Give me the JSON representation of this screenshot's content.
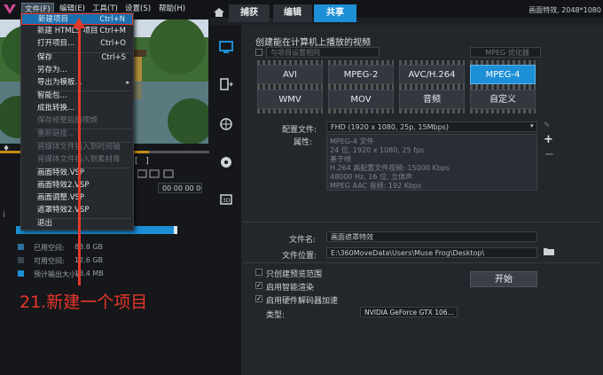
{
  "menubar": {
    "items": [
      {
        "label": "文件(F)",
        "active": true
      },
      {
        "label": "编辑(E)"
      },
      {
        "label": "工具(T)"
      },
      {
        "label": "设置(S)"
      },
      {
        "label": "帮助(H)"
      }
    ],
    "title": "画面特效, 2048*1080"
  },
  "tabs": [
    {
      "label": "捕获"
    },
    {
      "label": "编辑"
    },
    {
      "label": "共享",
      "selected": true
    }
  ],
  "file_menu": {
    "items": [
      {
        "label": "新建项目",
        "shortcut": "Ctrl+N",
        "highlight": true
      },
      {
        "label": "新建 HTML5 项目",
        "shortcut": "Ctrl+M"
      },
      {
        "label": "打开项目...",
        "shortcut": "Ctrl+O"
      },
      {
        "label": "保存",
        "shortcut": "Ctrl+S"
      },
      {
        "label": "另存为..."
      },
      {
        "label": "导出为模板...",
        "submenu": true
      },
      {
        "label": "智能包..."
      },
      {
        "label": "成批转换..."
      },
      {
        "label": "保存修整后的视频",
        "disabled": true
      },
      {
        "label": "重新链接...",
        "disabled": true
      },
      {
        "label": "将媒体文件插入到时间轴",
        "disabled": true
      },
      {
        "label": "将媒体文件插入到素材库",
        "disabled": true
      },
      {
        "label": "画面特效.VSP"
      },
      {
        "label": "画面特效2.VSP"
      },
      {
        "label": "画面调整.VSP"
      },
      {
        "label": "遮罩特效2.VSP"
      },
      {
        "label": "退出"
      }
    ]
  },
  "annotation": "21.新建一个项目",
  "left_stats": [
    {
      "label": "已用空间:",
      "value": "83.8 GB",
      "color": "#2e6f9e"
    },
    {
      "label": "可用空间:",
      "value": "12.6 GB",
      "color": "#3d4650"
    },
    {
      "label": "预计输出大小:",
      "value": "13.4 MB",
      "color": "#1c8fd6"
    }
  ],
  "timecode": "00 00 00 00",
  "share": {
    "heading": "创建能在计算机上播放的视频",
    "checkbox_top_label": "与项目设置相同",
    "optimize_label": "MPEG 优化器",
    "formats_row1": [
      {
        "label": "AVI"
      },
      {
        "label": "MPEG-2"
      },
      {
        "label": "AVC/H.264"
      },
      {
        "label": "MPEG-4",
        "selected": true
      }
    ],
    "formats_row2": [
      {
        "label": "WMV"
      },
      {
        "label": "MOV"
      },
      {
        "label": "音频"
      },
      {
        "label": "自定义"
      }
    ],
    "profile_label": "配置文件:",
    "profile_value": "FHD (1920 x 1080, 25p, 15Mbps)",
    "properties_label": "属性:",
    "properties": [
      "MPEG-4 文件",
      "24 位, 1920 x 1080, 25 fps",
      "基于帧",
      "H.264 高配置文件视频: 15000 Kbps",
      "48000 Hz, 16 位, 立体声",
      "MPEG AAC 音频: 192 Kbps"
    ],
    "filename_label": "文件名:",
    "filename_value": "画面遮罩特效",
    "location_label": "文件位置:",
    "location_value": "E:\\360MoveData\\Users\\Muse Frog\\Desktop\\",
    "options": [
      {
        "label": "只创建预览范围",
        "checked": false
      },
      {
        "label": "启用智能渲染",
        "checked": true
      },
      {
        "label": "启用硬件解码器加速",
        "checked": true
      }
    ],
    "type_label": "类型:",
    "gpu_value": "NVIDIA GeForce GTX 106...",
    "start_label": "开始"
  },
  "colors": {
    "accent": "#1c8fd6",
    "annotation_red": "#e23a2b",
    "scrub_orange": "#c88a14"
  }
}
